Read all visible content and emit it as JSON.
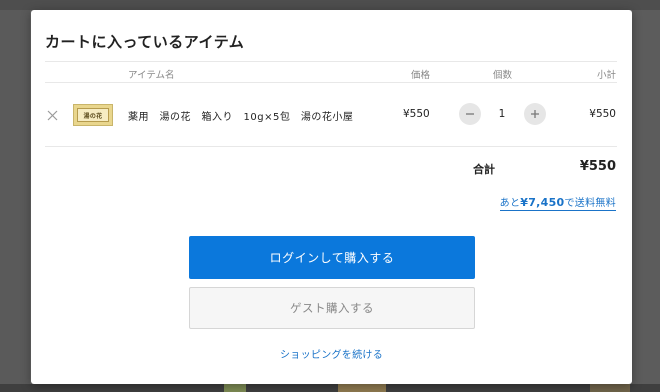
{
  "modal": {
    "title": "カートに入っているアイテム",
    "columns": {
      "name": "アイテム名",
      "price": "価格",
      "quantity": "個数",
      "subtotal": "小計"
    },
    "items": [
      {
        "name": "薬用　湯の花　箱入り　10g×5包　湯の花小屋",
        "thumb_label": "湯の花",
        "price": "¥550",
        "quantity": "1",
        "subtotal": "¥550"
      }
    ],
    "total_label": "合計",
    "total_value": "¥550",
    "shipping": {
      "prefix": "あと",
      "amount": "¥7,450",
      "suffix": "で送料無料"
    },
    "login_button": "ログインして購入する",
    "guest_button": "ゲスト購入する",
    "continue_link": "ショッピングを続ける"
  },
  "colors": {
    "accent": "#0b78dc",
    "link": "#1a73c8",
    "backdrop": "#666666"
  },
  "icons": {
    "remove": "close-icon",
    "decrease": "minus-icon",
    "increase": "plus-icon"
  }
}
